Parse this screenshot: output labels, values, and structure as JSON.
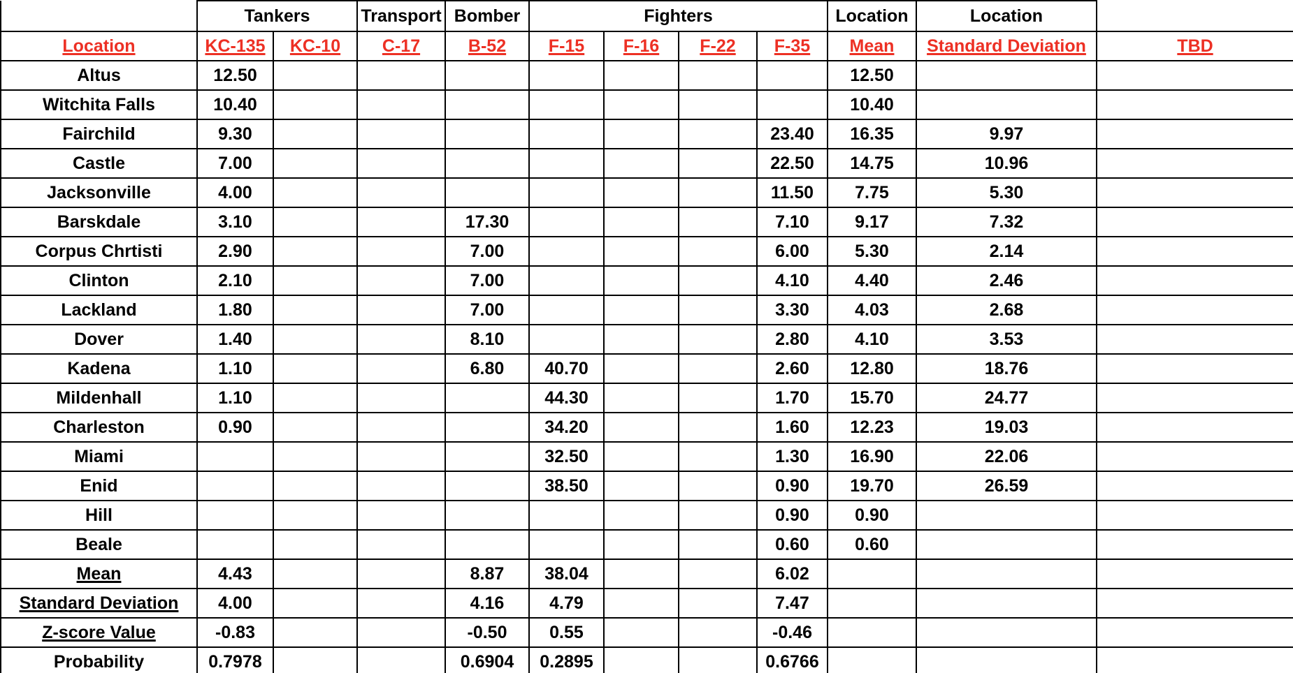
{
  "sheet": {
    "group_headers": [
      {
        "label": "",
        "span": 1
      },
      {
        "label": "Tankers",
        "span": 2
      },
      {
        "label": "Transport",
        "span": 1
      },
      {
        "label": "Bomber",
        "span": 1
      },
      {
        "label": "Fighters",
        "span": 4
      },
      {
        "label": "Location",
        "span": 1
      },
      {
        "label": "Location",
        "span": 1
      },
      {
        "label": "",
        "span": 1
      }
    ],
    "columns": [
      {
        "label": "Location",
        "style": "red"
      },
      {
        "label": "KC-135",
        "style": "red"
      },
      {
        "label": "KC-10",
        "style": "red"
      },
      {
        "label": "C-17",
        "style": "red"
      },
      {
        "label": "B-52",
        "style": "red"
      },
      {
        "label": "F-15",
        "style": "red"
      },
      {
        "label": "F-16",
        "style": "red"
      },
      {
        "label": "F-22",
        "style": "red"
      },
      {
        "label": "F-35",
        "style": "red"
      },
      {
        "label": "Mean",
        "style": "red"
      },
      {
        "label": "Standard Deviation",
        "style": "red"
      },
      {
        "label": "TBD",
        "style": "red"
      }
    ],
    "rows": [
      {
        "label": "Altus",
        "label_style": "plain",
        "cells": [
          "12.50",
          "",
          "",
          "",
          "",
          "",
          "",
          "",
          "12.50",
          "",
          ""
        ]
      },
      {
        "label": "Witchita Falls",
        "label_style": "plain",
        "cells": [
          "10.40",
          "",
          "",
          "",
          "",
          "",
          "",
          "",
          "10.40",
          "",
          ""
        ]
      },
      {
        "label": "Fairchild",
        "label_style": "plain",
        "cells": [
          "9.30",
          "",
          "",
          "",
          "",
          "",
          "",
          "23.40",
          "16.35",
          "9.97",
          ""
        ]
      },
      {
        "label": "Castle",
        "label_style": "plain",
        "cells": [
          "7.00",
          "",
          "",
          "",
          "",
          "",
          "",
          "22.50",
          "14.75",
          "10.96",
          ""
        ]
      },
      {
        "label": "Jacksonville",
        "label_style": "plain",
        "cells": [
          "4.00",
          "",
          "",
          "",
          "",
          "",
          "",
          "11.50",
          "7.75",
          "5.30",
          ""
        ]
      },
      {
        "label": "Barskdale",
        "label_style": "plain",
        "cells": [
          "3.10",
          "",
          "",
          "17.30",
          "",
          "",
          "",
          "7.10",
          "9.17",
          "7.32",
          ""
        ]
      },
      {
        "label": "Corpus Chrtisti",
        "label_style": "plain",
        "cells": [
          "2.90",
          "",
          "",
          "7.00",
          "",
          "",
          "",
          "6.00",
          "5.30",
          "2.14",
          ""
        ]
      },
      {
        "label": "Clinton",
        "label_style": "plain",
        "cells": [
          "2.10",
          "",
          "",
          "7.00",
          "",
          "",
          "",
          "4.10",
          "4.40",
          "2.46",
          ""
        ]
      },
      {
        "label": "Lackland",
        "label_style": "plain",
        "cells": [
          "1.80",
          "",
          "",
          "7.00",
          "",
          "",
          "",
          "3.30",
          "4.03",
          "2.68",
          ""
        ]
      },
      {
        "label": "Dover",
        "label_style": "plain",
        "cells": [
          "1.40",
          "",
          "",
          "8.10",
          "",
          "",
          "",
          "2.80",
          "4.10",
          "3.53",
          ""
        ]
      },
      {
        "label": "Kadena",
        "label_style": "plain",
        "cells": [
          "1.10",
          "",
          "",
          "6.80",
          "40.70",
          "",
          "",
          "2.60",
          "12.80",
          "18.76",
          ""
        ]
      },
      {
        "label": "Mildenhall",
        "label_style": "plain",
        "cells": [
          "1.10",
          "",
          "",
          "",
          "44.30",
          "",
          "",
          "1.70",
          "15.70",
          "24.77",
          ""
        ]
      },
      {
        "label": "Charleston",
        "label_style": "plain",
        "cells": [
          "0.90",
          "",
          "",
          "",
          "34.20",
          "",
          "",
          "1.60",
          "12.23",
          "19.03",
          ""
        ]
      },
      {
        "label": "Miami",
        "label_style": "plain",
        "cells": [
          "",
          "",
          "",
          "",
          "32.50",
          "",
          "",
          "1.30",
          "16.90",
          "22.06",
          ""
        ]
      },
      {
        "label": "Enid",
        "label_style": "plain",
        "cells": [
          "",
          "",
          "",
          "",
          "38.50",
          "",
          "",
          "0.90",
          "19.70",
          "26.59",
          ""
        ]
      },
      {
        "label": "Hill",
        "label_style": "plain",
        "cells": [
          "",
          "",
          "",
          "",
          "",
          "",
          "",
          "0.90",
          "0.90",
          "",
          ""
        ]
      },
      {
        "label": "Beale",
        "label_style": "plain",
        "cells": [
          "",
          "",
          "",
          "",
          "",
          "",
          "",
          "0.60",
          "0.60",
          "",
          ""
        ]
      },
      {
        "label": "Mean",
        "label_style": "underline",
        "cells": [
          "4.43",
          "",
          "",
          "8.87",
          "38.04",
          "",
          "",
          "6.02",
          "",
          "",
          ""
        ]
      },
      {
        "label": "Standard Deviation",
        "label_style": "underline",
        "cells": [
          "4.00",
          "",
          "",
          "4.16",
          "4.79",
          "",
          "",
          "7.47",
          "",
          "",
          ""
        ]
      },
      {
        "label": "Z-score Value",
        "label_style": "underline",
        "cells": [
          "-0.83",
          "",
          "",
          "-0.50",
          "0.55",
          "",
          "",
          "-0.46",
          "",
          "",
          ""
        ]
      },
      {
        "label": "Probability",
        "label_style": "plain",
        "cells": [
          "0.7978",
          "",
          "",
          "0.6904",
          "0.2895",
          "",
          "",
          "0.6766",
          "",
          "",
          ""
        ]
      }
    ]
  },
  "colors": {
    "header_red": "#ED3024",
    "text_black": "#000000",
    "grid_line": "#000000",
    "background": "#FFFFFF"
  }
}
